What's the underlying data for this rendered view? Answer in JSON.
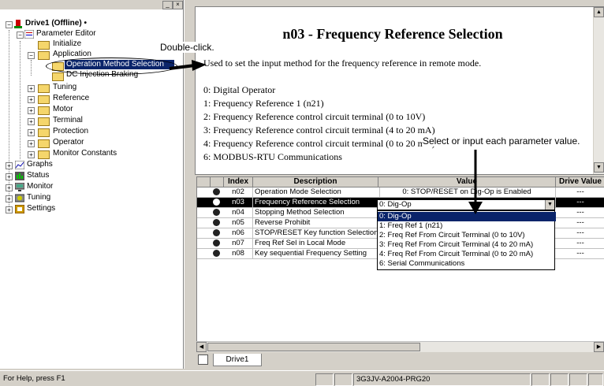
{
  "tree": {
    "root": "Drive1 (Offline) •",
    "items": [
      {
        "label": "Parameter Editor"
      },
      {
        "label": "Initialize"
      },
      {
        "label": "Application"
      },
      {
        "label": "Operation Method Selection"
      },
      {
        "label": "DC Injection Braking"
      },
      {
        "label": "Tuning"
      },
      {
        "label": "Reference"
      },
      {
        "label": "Motor"
      },
      {
        "label": "Terminal"
      },
      {
        "label": "Protection"
      },
      {
        "label": "Operator"
      },
      {
        "label": "Monitor Constants"
      },
      {
        "label": "Graphs"
      },
      {
        "label": "Status"
      },
      {
        "label": "Monitor"
      },
      {
        "label": "Tuning"
      },
      {
        "label": "Settings"
      }
    ]
  },
  "help": {
    "title": "n03 - Frequency Reference Selection",
    "intro": "Used to set the input method for the frequency reference in remote mode.",
    "lines": [
      "0: Digital Operator",
      "1: Frequency Reference 1 (n21)",
      "2: Frequency Reference control circuit terminal (0 to 10V)",
      "3: Frequency Reference control circuit terminal (4 to 20 mA)",
      "4: Frequency Reference control circuit terminal (0 to 20 mA)",
      "6: MODBUS-RTU Communications"
    ]
  },
  "annotations": {
    "double_click": "Double-click.",
    "select_input": "Select or input each parameter value."
  },
  "grid": {
    "headers": [
      "Index",
      "Description",
      "Value",
      "Drive Value"
    ],
    "rows": [
      {
        "index": "n02",
        "description": "Operation Mode Selection",
        "value": "0: STOP/RESET on Dig-Op is Enabled",
        "drive": "---"
      },
      {
        "index": "n03",
        "description": "Frequency Reference Selection",
        "value": "0: Dig-Op",
        "drive": "---"
      },
      {
        "index": "n04",
        "description": "Stopping Method Selection",
        "value": "",
        "drive": "---"
      },
      {
        "index": "n05",
        "description": "Reverse Prohibit",
        "value": "",
        "drive": "---"
      },
      {
        "index": "n06",
        "description": "STOP/RESET Key function Selection",
        "value": "",
        "drive": "---"
      },
      {
        "index": "n07",
        "description": "Freq Ref Sel in Local Mode",
        "value": "",
        "drive": "---"
      },
      {
        "index": "n08",
        "description": "Key sequential Frequency Setting",
        "value": "",
        "drive": "---"
      }
    ]
  },
  "dropdown": {
    "current": "0: Dig-Op",
    "options": [
      "0: Dig-Op",
      "1: Freq Ref 1 (n21)",
      "2: Freq Ref From Circuit Terminal (0 to 10V)",
      "3: Freq Ref From Circuit Terminal (4 to 20 mA)",
      "4: Freq Ref From Circuit Terminal (0 to 20 mA)",
      "6: Serial Communications"
    ]
  },
  "tab": {
    "label": "Drive1"
  },
  "status": {
    "help": "For Help, press F1",
    "model": "3G3JV-A2004-PRG20"
  },
  "colors": {
    "selection": "#0a246a",
    "folder": "#f5d66b"
  }
}
